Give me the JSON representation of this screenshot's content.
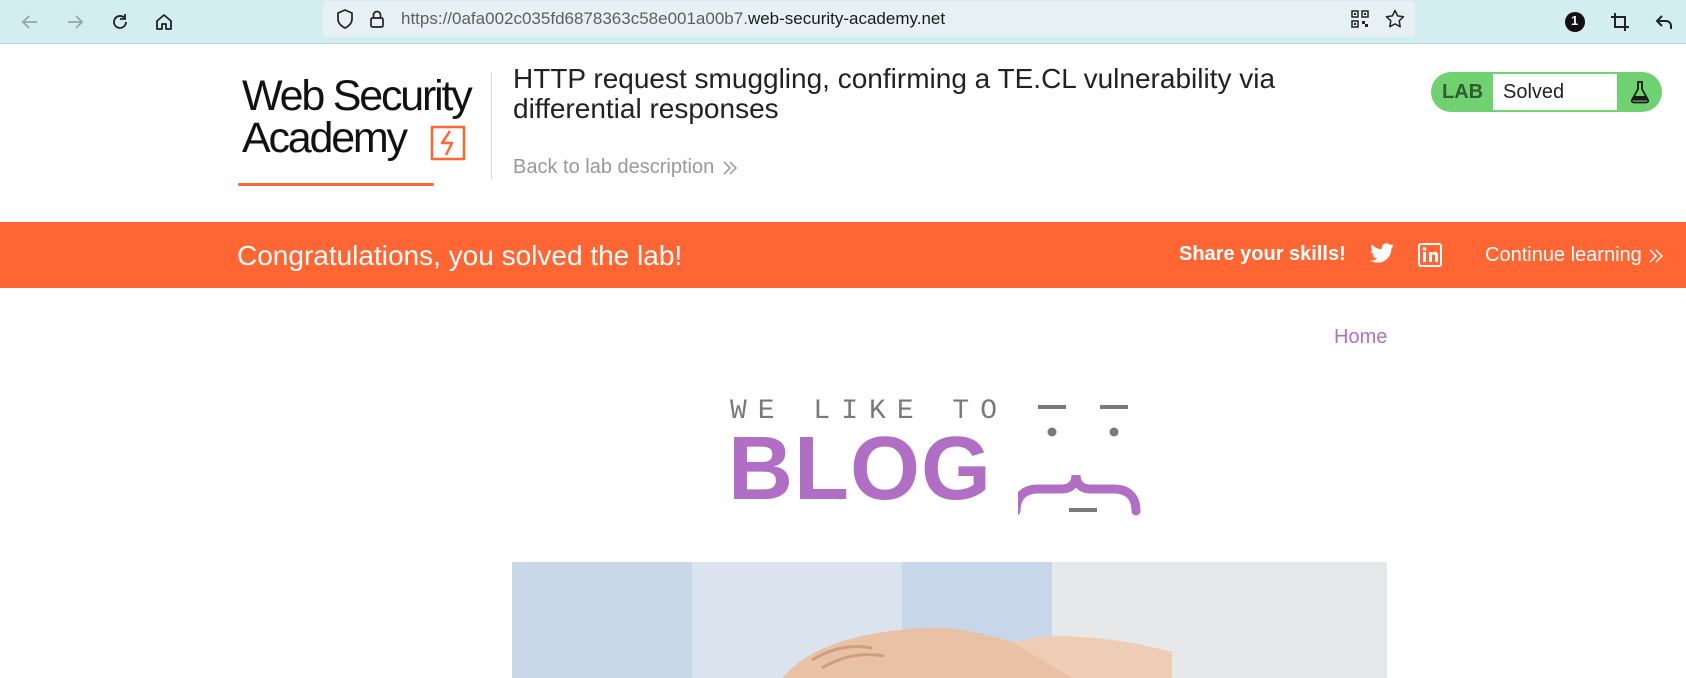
{
  "browser": {
    "url_prefix": "https://0afa002c035fd6878363c58e001a00b7.",
    "url_domain": "web-security-academy.net",
    "icons": [
      "back-icon",
      "forward-icon",
      "reload-icon",
      "home-icon",
      "shield-icon",
      "lock-icon",
      "qr-code-icon",
      "star-icon",
      "extension-badge-icon",
      "crop-icon",
      "undo-icon"
    ],
    "extension_badge": "1"
  },
  "header": {
    "logo_line1": "Web Security",
    "logo_line2": "Academy",
    "lab_title": "HTTP request smuggling, confirming a TE.CL vulnerability via differential responses",
    "back_link": "Back to lab description",
    "lab_tag": "LAB",
    "lab_status": "Solved"
  },
  "banner": {
    "congrats": "Congratulations, you solved the lab!",
    "share": "Share your skills!",
    "continue": "Continue learning"
  },
  "blog": {
    "home_link": "Home",
    "tagline": "WE LIKE TO",
    "title": "BLOG"
  },
  "colors": {
    "brand_orange": "#ff6633",
    "lab_green": "#70d171",
    "blog_purple": "#b06fc4",
    "chrome_bg": "#d2eef0"
  }
}
